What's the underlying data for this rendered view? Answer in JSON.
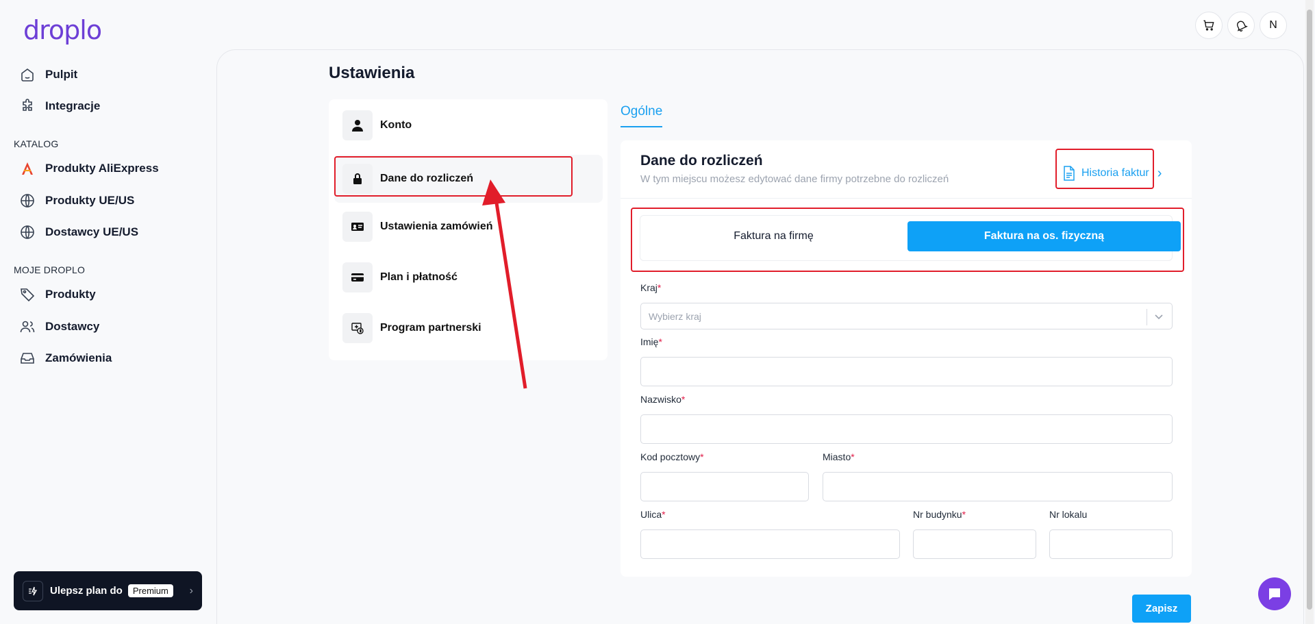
{
  "brand": {
    "logo": "droplo"
  },
  "sidebar": {
    "top_items": [
      {
        "label": "Pulpit",
        "icon": "home-icon"
      },
      {
        "label": "Integracje",
        "icon": "puzzle-icon"
      }
    ],
    "catalog_label": "KATALOG",
    "catalog_items": [
      {
        "label": "Produkty AliExpress",
        "icon": "aliexpress-icon"
      },
      {
        "label": "Produkty UE/US",
        "icon": "globe-icon"
      },
      {
        "label": "Dostawcy UE/US",
        "icon": "globe-icon"
      }
    ],
    "my_label": "MOJE DROPLO",
    "my_items": [
      {
        "label": "Produkty",
        "icon": "tag-icon"
      },
      {
        "label": "Dostawcy",
        "icon": "users-icon"
      },
      {
        "label": "Zamówienia",
        "icon": "inbox-icon"
      }
    ],
    "upgrade": {
      "label": "Ulepsz plan do",
      "badge": "Premium"
    }
  },
  "topbar": {
    "avatar": "N"
  },
  "page": {
    "title": "Ustawienia"
  },
  "settings_menu": [
    {
      "label": "Konto",
      "icon": "user-icon"
    },
    {
      "label": "Dane do rozliczeń",
      "icon": "lock-icon",
      "active": true
    },
    {
      "label": "Ustawienia zamówień",
      "icon": "id-card-icon"
    },
    {
      "label": "Plan i płatność",
      "icon": "credit-card-icon"
    },
    {
      "label": "Program partnerski",
      "icon": "partner-icon"
    }
  ],
  "tabs": {
    "general": "Ogólne"
  },
  "billing": {
    "title": "Dane do rozliczeń",
    "subtitle": "W tym miejscu możesz edytować dane firmy potrzebne do rozliczeń",
    "history_button": "Historia faktur",
    "invoice_company": "Faktura na firmę",
    "invoice_person": "Faktura na os. fizyczną",
    "fields": {
      "country": {
        "label": "Kraj",
        "placeholder": "Wybierz kraj"
      },
      "first_name": {
        "label": "Imię"
      },
      "last_name": {
        "label": "Nazwisko"
      },
      "postal_code": {
        "label": "Kod pocztowy"
      },
      "city": {
        "label": "Miasto"
      },
      "street": {
        "label": "Ulica"
      },
      "building": {
        "label": "Nr budynku"
      },
      "apartment": {
        "label": "Nr lokalu"
      }
    },
    "required_mark": "*",
    "save_button": "Zapisz"
  },
  "colors": {
    "accent": "#0ea1f7",
    "highlight": "#e11d2a",
    "chat": "#7b3fe4"
  }
}
